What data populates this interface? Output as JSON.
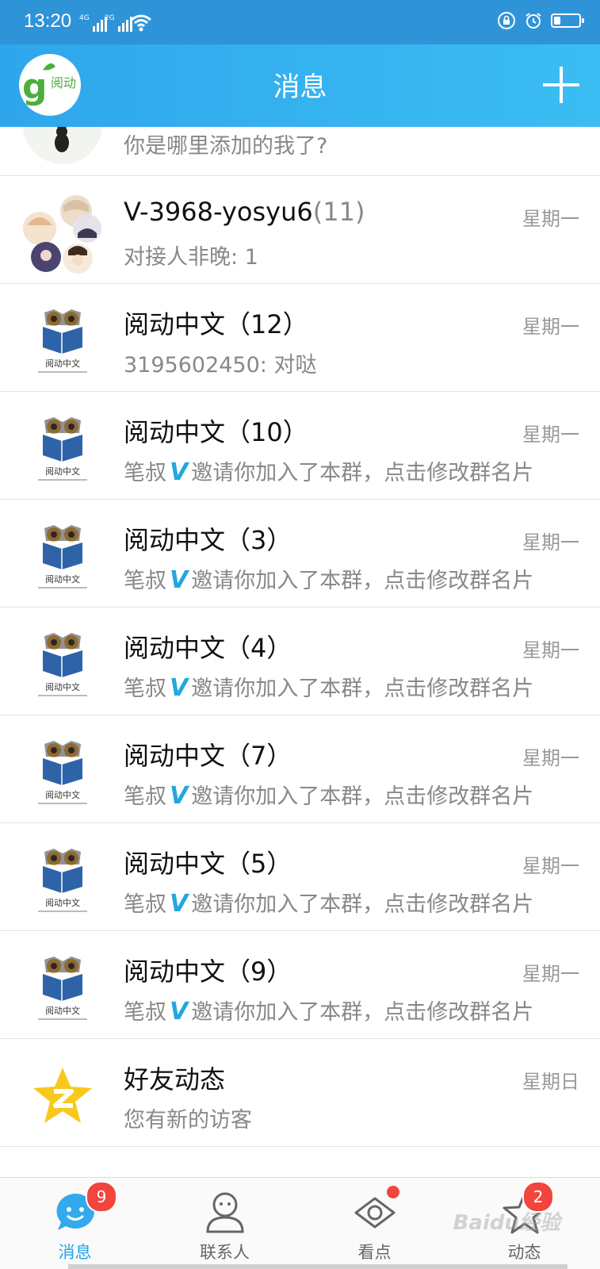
{
  "status_bar": {
    "time": "13:20",
    "sim1": "4G",
    "sim2": "2G"
  },
  "title_bar": {
    "title": "消息",
    "logo_text": "阅动"
  },
  "messages": [
    {
      "name": "",
      "preview": "你是哪里添加的我了?",
      "time": "",
      "avatar": "cat-avatar"
    },
    {
      "name": "V-3968-yosyu6",
      "count": "(11)",
      "preview": "对接人非晚: 1",
      "time": "星期一",
      "avatar": "group-collage-avatar"
    },
    {
      "name": "阅动中文（12）",
      "preview": "3195602450: 对哒",
      "time": "星期一",
      "avatar": "owl-book-avatar"
    },
    {
      "name": "阅动中文（10）",
      "preview_sender": "笔叔",
      "preview": "邀请你加入了本群，点击修改群名片",
      "time": "星期一",
      "avatar": "owl-book-avatar"
    },
    {
      "name": "阅动中文（3）",
      "preview_sender": "笔叔",
      "preview": "邀请你加入了本群，点击修改群名片",
      "time": "星期一",
      "avatar": "owl-book-avatar"
    },
    {
      "name": "阅动中文（4）",
      "preview_sender": "笔叔",
      "preview": "邀请你加入了本群，点击修改群名片",
      "time": "星期一",
      "avatar": "owl-book-avatar"
    },
    {
      "name": "阅动中文（7）",
      "preview_sender": "笔叔",
      "preview": "邀请你加入了本群，点击修改群名片",
      "time": "星期一",
      "avatar": "owl-book-avatar"
    },
    {
      "name": "阅动中文（5）",
      "preview_sender": "笔叔",
      "preview": "邀请你加入了本群，点击修改群名片",
      "time": "星期一",
      "avatar": "owl-book-avatar"
    },
    {
      "name": "阅动中文（9）",
      "preview_sender": "笔叔",
      "preview": "邀请你加入了本群，点击修改群名片",
      "time": "星期一",
      "avatar": "owl-book-avatar"
    },
    {
      "name": "好友动态",
      "preview": "您有新的访客",
      "time": "星期日",
      "avatar": "qzone-star-avatar"
    }
  ],
  "avatar_caption": "阅动中文",
  "v_badge": "V",
  "tabs": [
    {
      "label": "消息",
      "badge": "9",
      "icon": "chat-bubble-icon"
    },
    {
      "label": "联系人",
      "icon": "contacts-icon"
    },
    {
      "label": "看点",
      "icon": "eye-icon"
    },
    {
      "label": "动态",
      "badge": "2",
      "icon": "star-icon"
    }
  ],
  "watermark": "Baidu经验",
  "colors": {
    "header": "#2fa6ec",
    "active_tab": "#28a4e6",
    "badge": "#f1453d"
  }
}
